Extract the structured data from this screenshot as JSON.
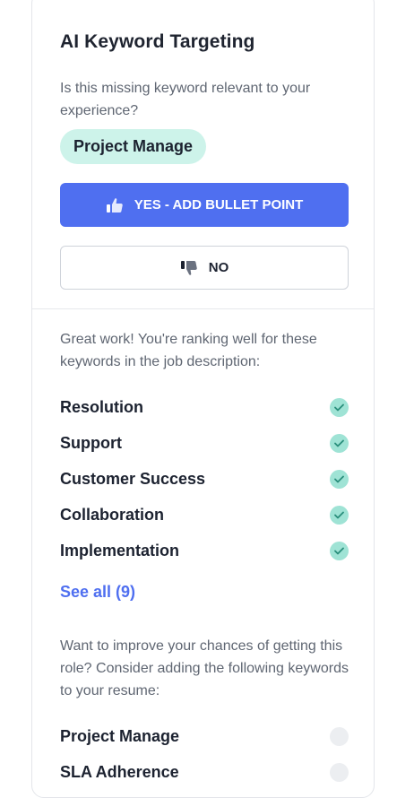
{
  "panel": {
    "title": "AI Keyword Targeting",
    "question": "Is this missing keyword relevant to your experience?",
    "current_keyword": "Project Manage",
    "yes_button": "YES - ADD BULLET POINT",
    "no_button": "NO"
  },
  "ranking": {
    "intro": "Great work! You're ranking well for these keywords in the job description:",
    "keywords": [
      {
        "label": "Resolution",
        "matched": true
      },
      {
        "label": "Support",
        "matched": true
      },
      {
        "label": "Customer Success",
        "matched": true
      },
      {
        "label": "Collaboration",
        "matched": true
      },
      {
        "label": "Implementation",
        "matched": true
      }
    ],
    "see_all": "See all (9)"
  },
  "improve": {
    "intro": "Want to improve your chances of getting this role? Consider adding the following keywords to your resume:",
    "keywords": [
      {
        "label": "Project Manage",
        "matched": false
      },
      {
        "label": "SLA Adherence",
        "matched": false
      }
    ]
  },
  "colors": {
    "accent": "#4f6ff0",
    "pill_bg": "#cdf3ea",
    "check_bg": "#9fe3d5"
  },
  "icons": {
    "yes": "thumbs-up-icon",
    "no": "thumbs-down-icon",
    "matched": "check-circle-icon",
    "unmatched": "empty-circle-icon"
  }
}
